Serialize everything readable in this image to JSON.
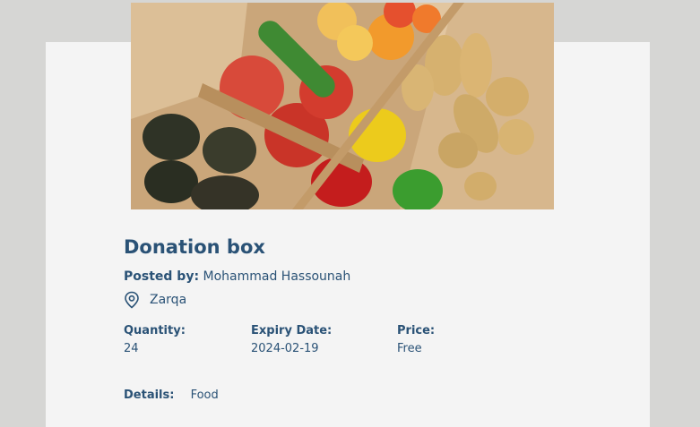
{
  "post": {
    "title": "Donation box",
    "posted_by_label": "Posted by:",
    "posted_by": "Mohammad Hassounah",
    "location_icon": "location-pin-icon",
    "location": "Zarqa",
    "quantity_label": "Quantity:",
    "quantity": "24",
    "expiry_label": "Expiry Date:",
    "expiry": "2024-02-19",
    "price_label": "Price:",
    "price": "Free",
    "details_label": "Details:",
    "details": "Food"
  },
  "colors": {
    "text": "#2a5276",
    "card": "#f4f4f4",
    "page": "#d6d6d4"
  }
}
